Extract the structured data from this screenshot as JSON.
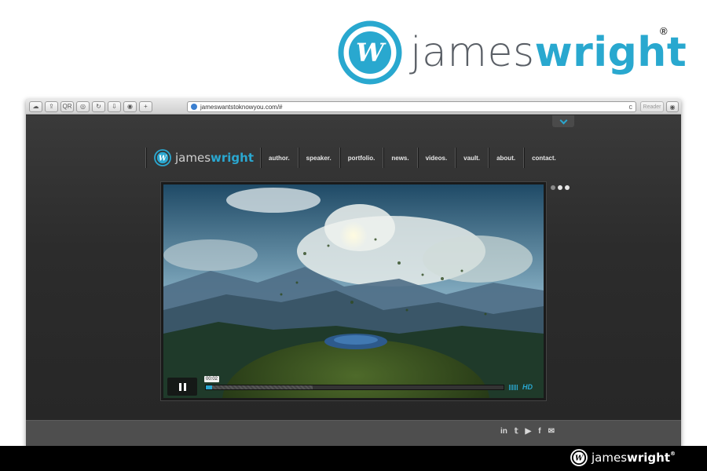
{
  "brand": {
    "word_light": "james",
    "word_bold": "wright",
    "registered": "®",
    "logo_letter": "W",
    "accent": "#29a8cf"
  },
  "browser": {
    "toolbar_buttons": [
      "◂ ▸",
      "☁",
      "⇪",
      "QR",
      "◎",
      "↻",
      "⇩",
      "◉",
      "+"
    ],
    "url": "jameswantstoknowyou.com/#",
    "reload_icon": "refresh-icon",
    "reader_label": "Reader"
  },
  "nav": {
    "logo_word_light": "james",
    "logo_word_bold": "wright",
    "items": [
      "author.",
      "speaker.",
      "portfolio.",
      "news.",
      "videos.",
      "vault.",
      "about.",
      "contact."
    ]
  },
  "video": {
    "current_time": "00:02",
    "progress": 0.02,
    "buffered": 0.36,
    "hd_label": "HD",
    "state": "playing"
  },
  "slider": {
    "count": 3,
    "active": [
      1,
      2
    ]
  },
  "social": [
    "in",
    "𝕥",
    "▶",
    "f",
    "✉"
  ],
  "bottom": {
    "word_light": "james",
    "word_bold": "wright",
    "registered": "®"
  }
}
